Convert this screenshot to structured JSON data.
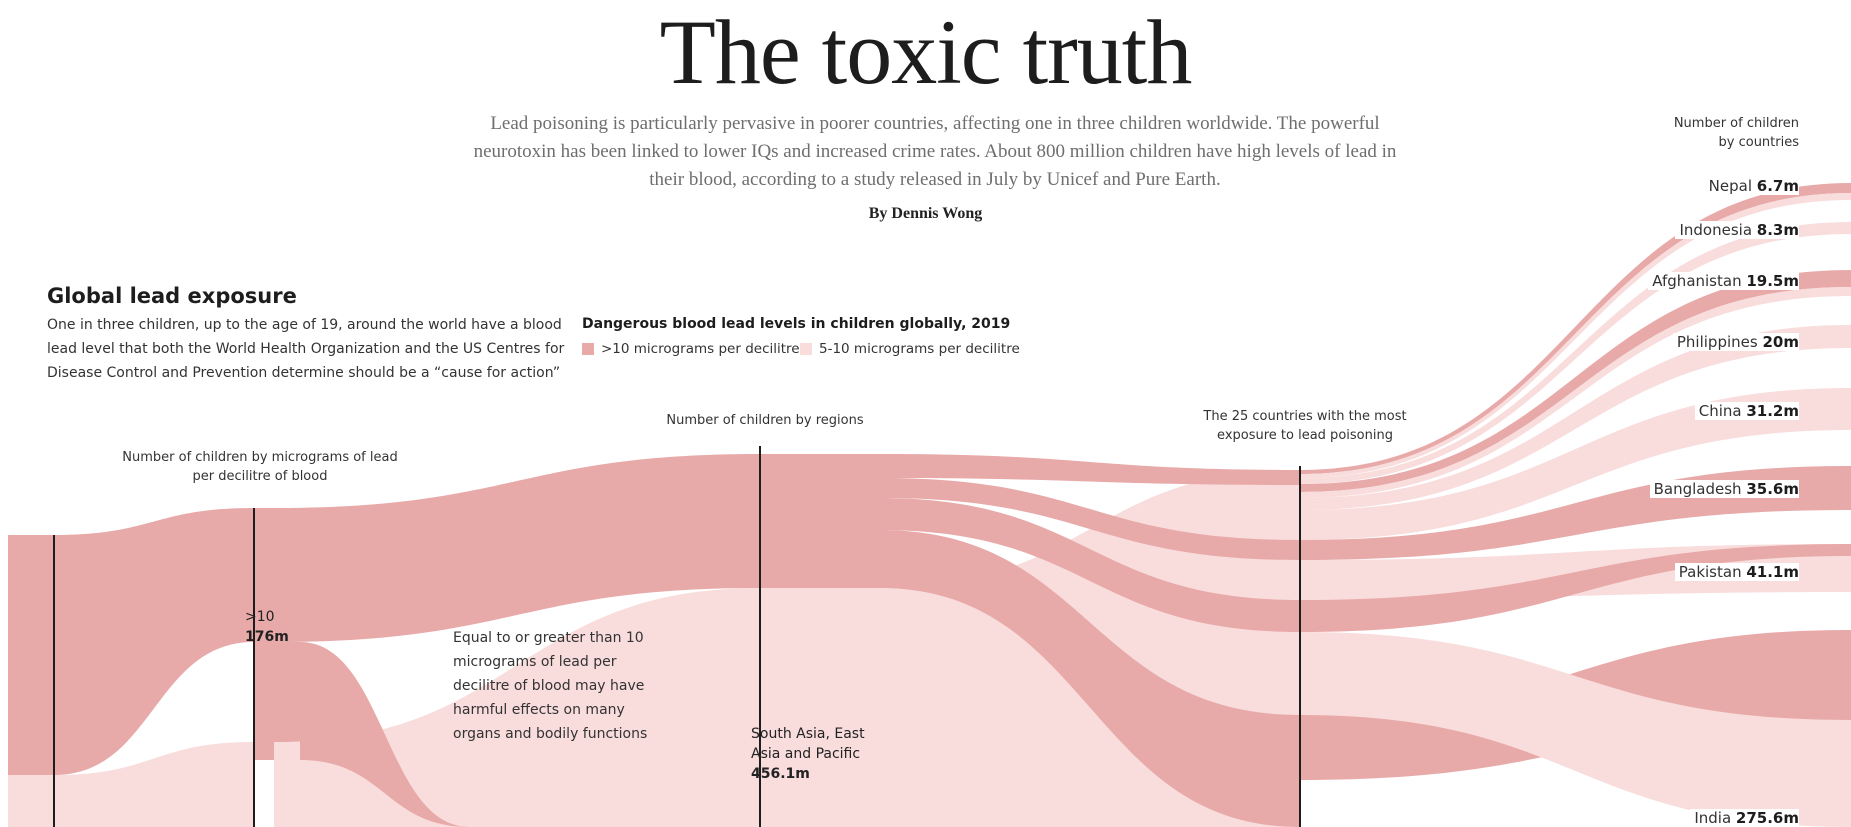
{
  "header": {
    "title": "The toxic truth",
    "intro": "Lead poisoning is particularly pervasive in poorer countries, affecting one in three children worldwide. The powerful neurotoxin has been linked to lower IQs and increased crime rates. About 800 million children have high levels of lead in their blood, according to a study released in July by Unicef and Pure Earth.",
    "byline": "By Dennis Wong"
  },
  "section": {
    "heading": "Global lead exposure",
    "description": "One in three children, up to the age of 19, around the world have a blood lead level that both the World Health Organization and the US Centres for Disease Control and Prevention determine should be a “cause for action”"
  },
  "colors": {
    "high": "#e8a9a9",
    "low": "#f9dcdc",
    "axis": "#1d1d1d"
  },
  "chart_data": {
    "type": "sankey",
    "subtitle": "Dangerous blood lead levels in children globally, 2019",
    "legend": [
      {
        "label": ">10 micrograms per decilitre",
        "level": "high"
      },
      {
        "label": "5-10 micrograms per decilitre",
        "level": "low"
      }
    ],
    "stages": [
      {
        "heading": "",
        "label": "",
        "value": ""
      },
      {
        "heading": "Number of children by micrograms of lead per decilitre of blood",
        "label": ">10",
        "value": "176m"
      },
      {
        "heading": "Number of children by regions",
        "label": "South Asia, East Asia and Pacific",
        "value": "456.1m"
      },
      {
        "heading": "The 25 countries with the most exposure to lead poisoning",
        "label": "",
        "value": ""
      }
    ],
    "annotation": "Equal to or greater than 10 micrograms of lead per decilitre of blood may have harmful effects on many organs and bodily functions",
    "countries_header": "Number of children by countries",
    "countries": [
      {
        "name": "Nepal",
        "value": "6.7m",
        "millions": 6.7
      },
      {
        "name": "Indonesia",
        "value": "8.3m",
        "millions": 8.3
      },
      {
        "name": "Afghanistan",
        "value": "19.5m",
        "millions": 19.5
      },
      {
        "name": "Philippines",
        "value": "20m",
        "millions": 20
      },
      {
        "name": "China",
        "value": "31.2m",
        "millions": 31.2
      },
      {
        "name": "Bangladesh",
        "value": "35.6m",
        "millions": 35.6
      },
      {
        "name": "Pakistan",
        "value": "41.1m",
        "millions": 41.1
      },
      {
        "name": "India",
        "value": "275.6m",
        "millions": 275.6
      }
    ]
  }
}
